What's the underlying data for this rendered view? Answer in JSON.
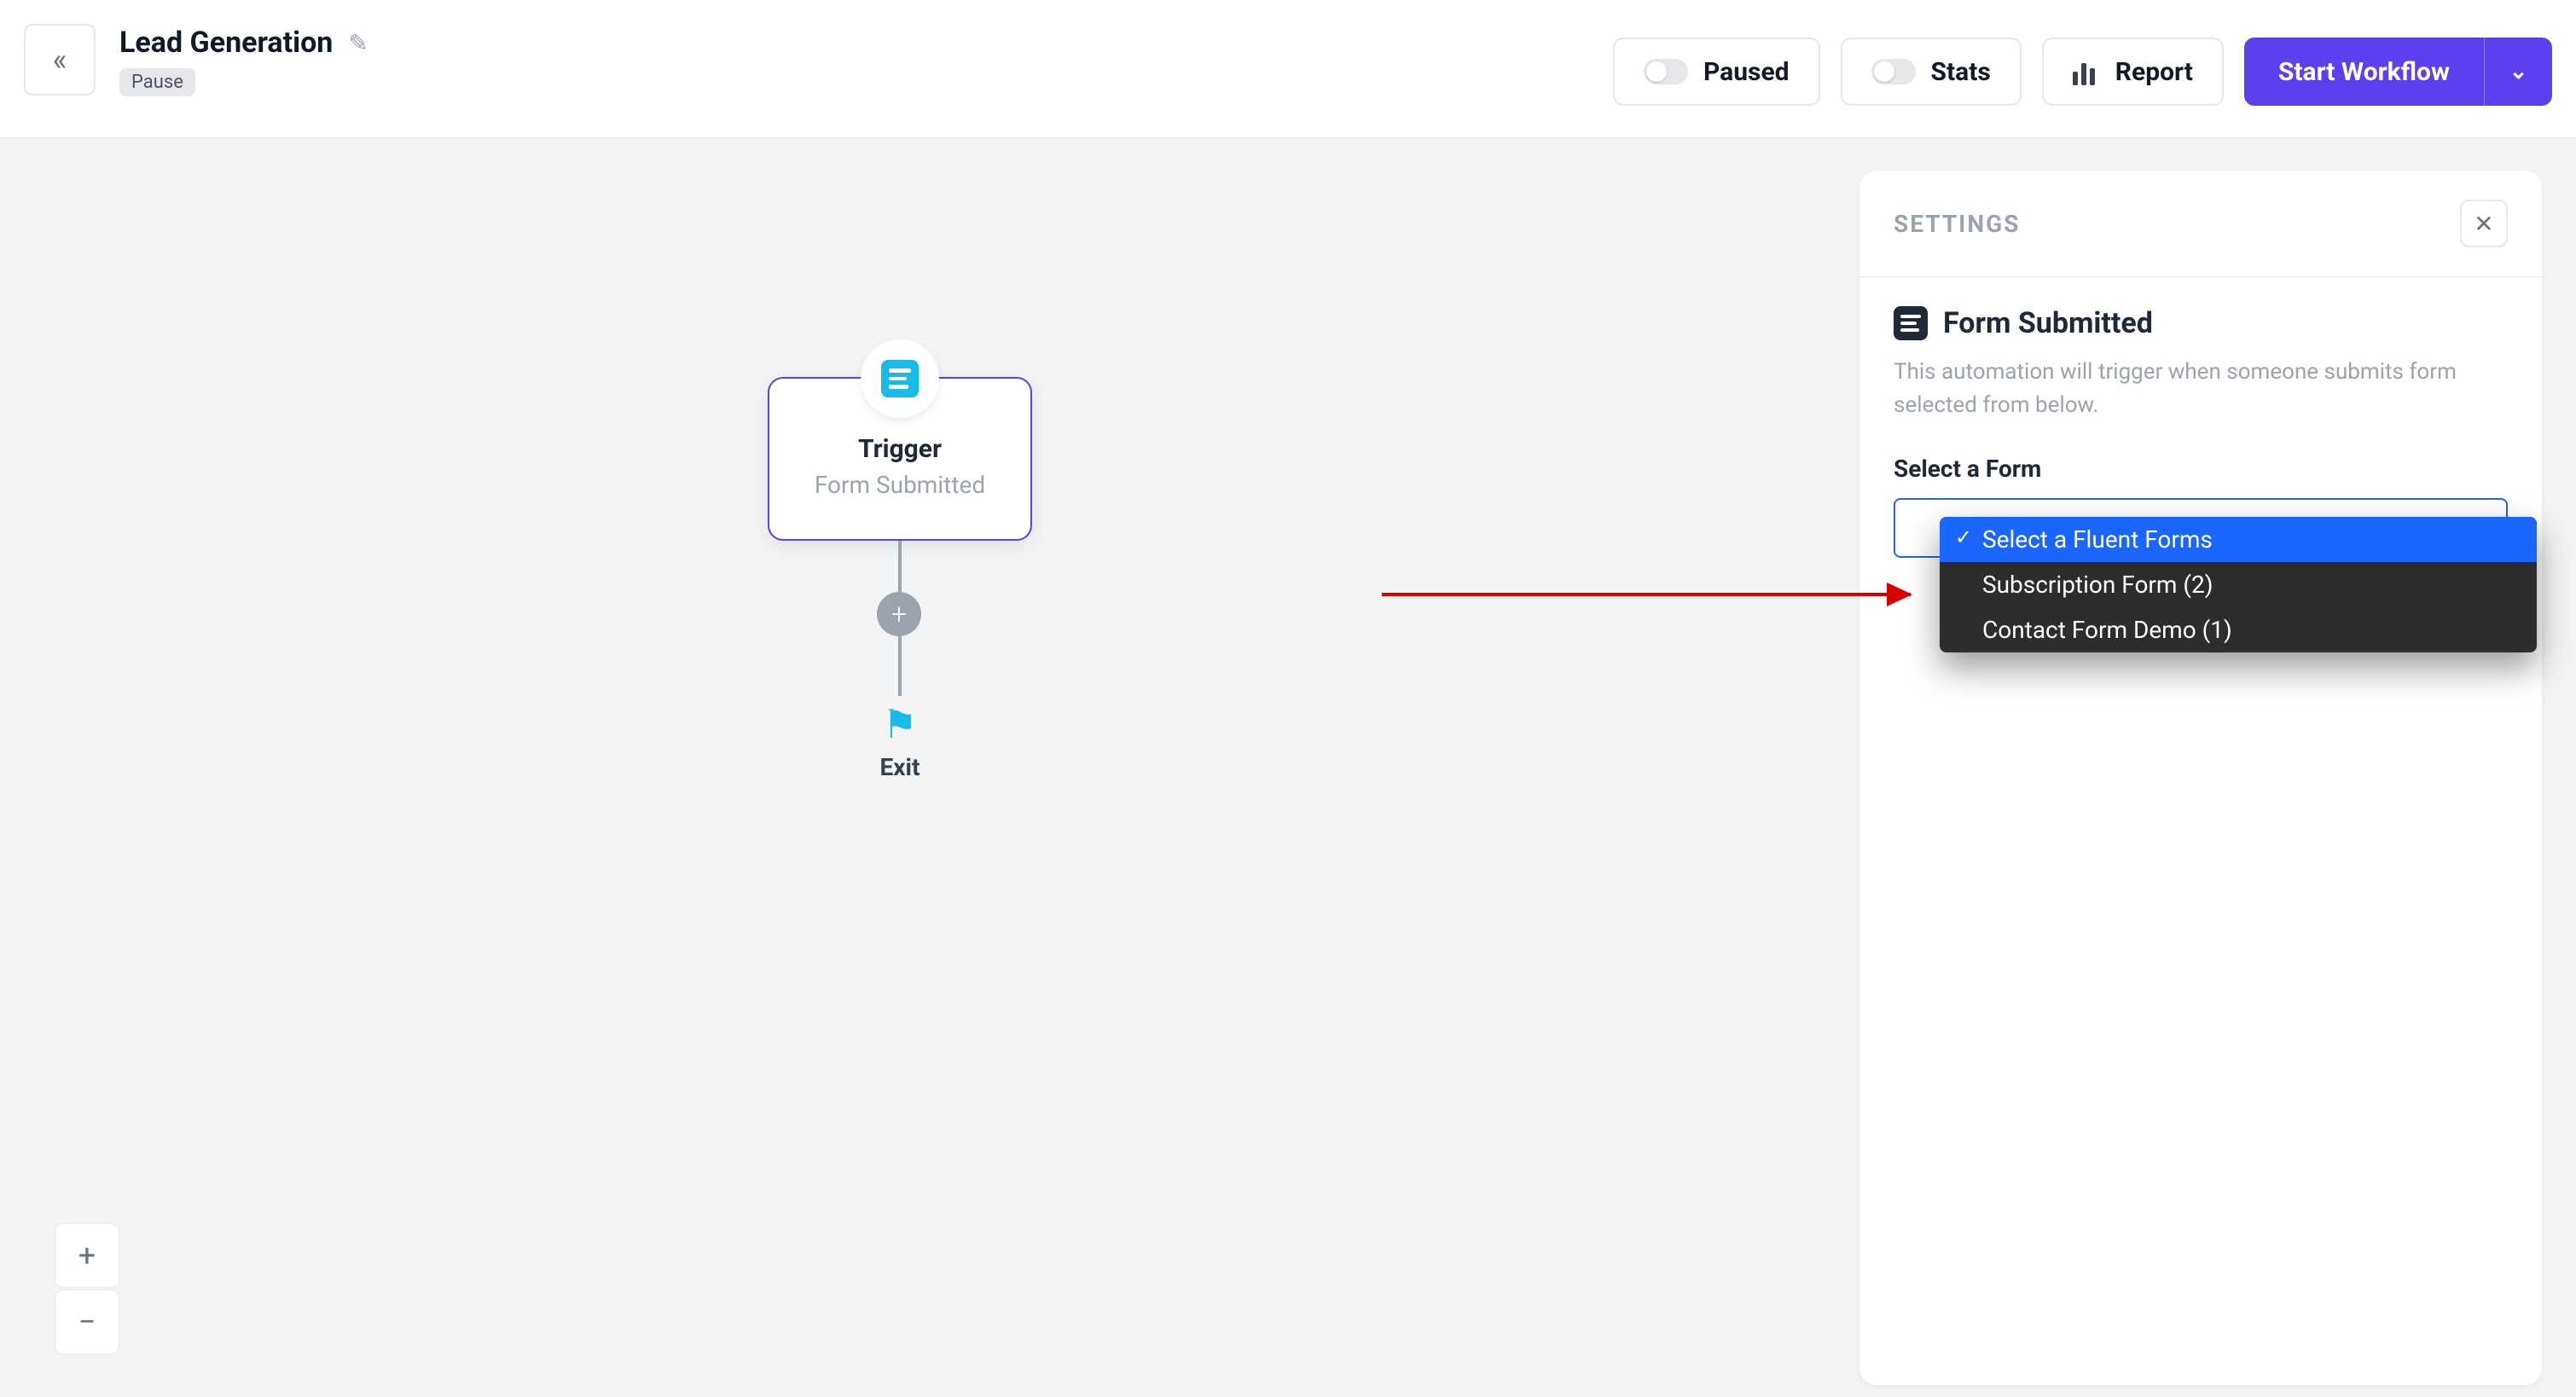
{
  "header": {
    "title": "Lead Generation",
    "status_pill": "Pause",
    "paused_label": "Paused",
    "stats_label": "Stats",
    "report_label": "Report",
    "start_label": "Start Workflow"
  },
  "canvas": {
    "trigger": {
      "title": "Trigger",
      "subtitle": "Form Submitted"
    },
    "exit_label": "Exit"
  },
  "settings": {
    "header": "SETTINGS",
    "title": "Form Submitted",
    "description": "This automation will trigger when someone submits form selected from below.",
    "field_label": "Select a Form",
    "dropdown": {
      "options": [
        "Select a Fluent Forms",
        "Subscription Form (2)",
        "Contact Form Demo (1)"
      ]
    }
  }
}
